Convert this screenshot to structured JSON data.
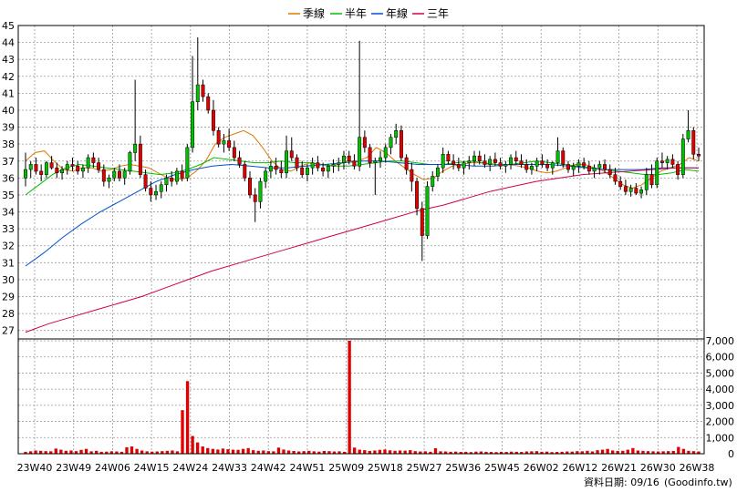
{
  "legend": [
    {
      "label": "季線",
      "color": "#e07800"
    },
    {
      "label": "半年",
      "color": "#00c000"
    },
    {
      "label": "年線",
      "color": "#0050d0"
    },
    {
      "label": "三年",
      "color": "#d0004a"
    }
  ],
  "footer_text": "資料日期: 09/16",
  "source_text": "(Goodinfo.tw)",
  "chart_data": [
    {
      "type": "candlestick",
      "title": "",
      "ylim": [
        26.5,
        45
      ],
      "yticks": [
        27,
        28,
        29,
        30,
        31,
        32,
        33,
        34,
        35,
        36,
        37,
        38,
        39,
        40,
        41,
        42,
        43,
        44,
        45
      ],
      "xticks": [
        "23W40",
        "23W49",
        "24W06",
        "24W15",
        "24W24",
        "24W33",
        "24W42",
        "24W51",
        "25W09",
        "25W18",
        "25W27",
        "25W36",
        "25W45",
        "26W02",
        "26W12",
        "26W21",
        "26W30",
        "26W38"
      ],
      "grid": true,
      "up_color": "#00c000",
      "down_color": "#e00000",
      "candles": [
        [
          36.0,
          37.5,
          35.5,
          36.5
        ],
        [
          36.5,
          37.0,
          36.0,
          36.8
        ],
        [
          36.8,
          37.2,
          36.2,
          36.4
        ],
        [
          36.4,
          36.8,
          35.8,
          36.2
        ],
        [
          36.2,
          37.0,
          36.0,
          36.9
        ],
        [
          36.9,
          37.3,
          36.5,
          36.6
        ],
        [
          36.6,
          36.9,
          36.0,
          36.3
        ],
        [
          36.3,
          36.7,
          35.9,
          36.5
        ],
        [
          36.5,
          37.0,
          36.2,
          36.8
        ],
        [
          36.8,
          37.2,
          36.4,
          36.7
        ],
        [
          36.7,
          37.0,
          36.2,
          36.4
        ],
        [
          36.4,
          36.8,
          36.0,
          36.6
        ],
        [
          36.6,
          37.4,
          36.3,
          37.2
        ],
        [
          37.2,
          37.5,
          36.6,
          36.9
        ],
        [
          36.9,
          37.2,
          36.3,
          36.5
        ],
        [
          36.5,
          36.8,
          35.5,
          35.8
        ],
        [
          35.8,
          36.2,
          35.4,
          36.0
        ],
        [
          36.0,
          36.6,
          35.8,
          36.4
        ],
        [
          36.4,
          36.8,
          35.8,
          36.0
        ],
        [
          36.0,
          36.6,
          35.6,
          36.4
        ],
        [
          36.4,
          37.6,
          36.2,
          37.5
        ],
        [
          37.5,
          41.8,
          37.0,
          38.0
        ],
        [
          38.0,
          38.5,
          36.0,
          36.2
        ],
        [
          36.2,
          36.5,
          35.2,
          35.4
        ],
        [
          35.4,
          35.8,
          34.6,
          35.0
        ],
        [
          35.0,
          35.6,
          34.7,
          35.2
        ],
        [
          35.2,
          35.8,
          34.8,
          35.6
        ],
        [
          35.6,
          36.2,
          35.2,
          36.0
        ],
        [
          36.0,
          36.4,
          35.5,
          35.8
        ],
        [
          35.8,
          36.6,
          35.6,
          36.4
        ],
        [
          36.4,
          36.8,
          35.8,
          36.0
        ],
        [
          36.0,
          38.0,
          35.8,
          37.8
        ],
        [
          37.8,
          43.2,
          37.5,
          40.5
        ],
        [
          40.5,
          44.3,
          40.0,
          41.5
        ],
        [
          41.5,
          41.8,
          40.5,
          40.8
        ],
        [
          40.8,
          41.0,
          39.8,
          40.0
        ],
        [
          40.0,
          40.6,
          38.5,
          38.8
        ],
        [
          38.8,
          39.0,
          37.8,
          38.0
        ],
        [
          38.0,
          38.6,
          37.5,
          38.2
        ],
        [
          38.2,
          38.9,
          37.6,
          37.8
        ],
        [
          37.8,
          38.2,
          37.0,
          37.2
        ],
        [
          37.2,
          37.6,
          36.6,
          36.8
        ],
        [
          36.8,
          37.0,
          35.8,
          36.0
        ],
        [
          36.0,
          36.4,
          34.8,
          35.0
        ],
        [
          35.0,
          35.4,
          33.4,
          34.6
        ],
        [
          34.6,
          36.0,
          34.2,
          35.8
        ],
        [
          35.8,
          36.6,
          35.4,
          36.4
        ],
        [
          36.4,
          37.0,
          36.0,
          36.7
        ],
        [
          36.7,
          37.2,
          36.2,
          36.5
        ],
        [
          36.5,
          37.0,
          36.0,
          36.3
        ],
        [
          36.3,
          38.5,
          36.0,
          37.6
        ],
        [
          37.6,
          38.4,
          37.0,
          37.2
        ],
        [
          37.2,
          37.4,
          36.4,
          36.6
        ],
        [
          36.6,
          37.0,
          36.0,
          36.2
        ],
        [
          36.2,
          36.8,
          35.8,
          36.6
        ],
        [
          36.6,
          37.2,
          36.2,
          36.9
        ],
        [
          36.9,
          37.3,
          36.4,
          36.6
        ],
        [
          36.6,
          36.9,
          36.1,
          36.4
        ],
        [
          36.4,
          36.8,
          36.0,
          36.7
        ],
        [
          36.7,
          37.1,
          36.3,
          36.8
        ],
        [
          36.8,
          37.2,
          36.4,
          36.9
        ],
        [
          36.9,
          37.6,
          36.5,
          37.3
        ],
        [
          37.3,
          37.6,
          36.8,
          37.0
        ],
        [
          37.0,
          37.4,
          36.5,
          36.7
        ],
        [
          36.7,
          44.1,
          36.4,
          38.4
        ],
        [
          38.4,
          38.8,
          37.5,
          37.8
        ],
        [
          37.8,
          38.0,
          36.6,
          36.9
        ],
        [
          36.9,
          37.2,
          35.0,
          37.0
        ],
        [
          37.0,
          37.6,
          36.6,
          37.2
        ],
        [
          37.2,
          38.0,
          36.9,
          37.8
        ],
        [
          37.8,
          38.6,
          37.4,
          38.4
        ],
        [
          38.4,
          39.2,
          38.0,
          38.8
        ],
        [
          38.8,
          39.1,
          37.0,
          37.2
        ],
        [
          37.2,
          37.4,
          36.2,
          36.5
        ],
        [
          36.5,
          36.9,
          35.2,
          35.8
        ],
        [
          35.8,
          36.0,
          33.8,
          34.2
        ],
        [
          34.2,
          34.6,
          31.1,
          32.6
        ],
        [
          32.6,
          35.8,
          32.4,
          35.5
        ],
        [
          35.5,
          36.4,
          35.2,
          36.1
        ],
        [
          36.1,
          36.8,
          35.8,
          36.6
        ],
        [
          36.6,
          37.8,
          36.3,
          37.4
        ],
        [
          37.4,
          37.6,
          36.8,
          37.0
        ],
        [
          37.0,
          37.4,
          36.5,
          36.8
        ],
        [
          36.8,
          37.2,
          36.4,
          36.6
        ],
        [
          36.6,
          37.0,
          36.2,
          36.9
        ],
        [
          36.9,
          37.3,
          36.5,
          37.0
        ],
        [
          37.0,
          37.6,
          36.7,
          37.3
        ],
        [
          37.3,
          37.6,
          36.8,
          37.0
        ],
        [
          37.0,
          37.4,
          36.6,
          36.8
        ],
        [
          36.8,
          37.3,
          36.4,
          37.1
        ],
        [
          37.1,
          37.5,
          36.7,
          36.9
        ],
        [
          36.9,
          37.2,
          36.5,
          36.7
        ],
        [
          36.7,
          37.0,
          36.3,
          36.8
        ],
        [
          36.8,
          37.4,
          36.5,
          37.2
        ],
        [
          37.2,
          37.6,
          36.8,
          37.0
        ],
        [
          37.0,
          37.4,
          36.6,
          36.8
        ],
        [
          36.8,
          37.1,
          36.3,
          36.5
        ],
        [
          36.5,
          36.9,
          36.2,
          36.7
        ],
        [
          36.7,
          37.2,
          36.4,
          37.0
        ],
        [
          37.0,
          37.4,
          36.6,
          36.8
        ],
        [
          36.8,
          37.1,
          36.4,
          36.6
        ],
        [
          36.6,
          37.0,
          36.2,
          36.9
        ],
        [
          36.9,
          38.4,
          36.7,
          37.6
        ],
        [
          37.6,
          37.8,
          36.6,
          36.8
        ],
        [
          36.8,
          37.0,
          36.3,
          36.5
        ],
        [
          36.5,
          36.9,
          36.1,
          36.7
        ],
        [
          36.7,
          37.1,
          36.3,
          36.9
        ],
        [
          36.9,
          37.2,
          36.5,
          36.7
        ],
        [
          36.7,
          37.0,
          36.2,
          36.4
        ],
        [
          36.4,
          36.8,
          36.0,
          36.6
        ],
        [
          36.6,
          37.0,
          36.2,
          36.8
        ],
        [
          36.8,
          37.1,
          36.3,
          36.5
        ],
        [
          36.5,
          36.8,
          36.0,
          36.2
        ],
        [
          36.2,
          36.6,
          35.6,
          35.8
        ],
        [
          35.8,
          36.1,
          35.3,
          35.5
        ],
        [
          35.5,
          35.9,
          35.0,
          35.2
        ],
        [
          35.2,
          35.6,
          34.9,
          35.4
        ],
        [
          35.4,
          35.7,
          35.0,
          35.1
        ],
        [
          35.1,
          35.5,
          34.8,
          35.3
        ],
        [
          35.3,
          36.6,
          35.0,
          36.2
        ],
        [
          36.2,
          36.8,
          35.4,
          35.6
        ],
        [
          35.6,
          37.2,
          35.4,
          37.0
        ],
        [
          37.0,
          37.5,
          36.6,
          36.9
        ],
        [
          36.9,
          37.3,
          36.5,
          37.1
        ],
        [
          37.1,
          37.4,
          36.6,
          36.8
        ],
        [
          36.8,
          37.0,
          35.9,
          36.2
        ],
        [
          36.2,
          38.6,
          36.0,
          38.3
        ],
        [
          38.3,
          40.0,
          38.1,
          38.8
        ],
        [
          38.8,
          39.0,
          37.1,
          37.4
        ],
        [
          37.4,
          37.8,
          37.0,
          37.3
        ]
      ],
      "volume_yticks": [
        "0",
        "1,000",
        "2,000",
        "3,000",
        "4,000",
        "5,000",
        "6,000",
        "7,000"
      ],
      "volume_ylim": [
        0,
        7000
      ],
      "volume": [
        120,
        150,
        200,
        180,
        160,
        150,
        320,
        250,
        180,
        200,
        160,
        240,
        300,
        150,
        180,
        120,
        130,
        150,
        140,
        120,
        400,
        450,
        300,
        200,
        150,
        130,
        140,
        160,
        180,
        200,
        150,
        2700,
        4500,
        1100,
        700,
        450,
        350,
        300,
        260,
        320,
        280,
        250,
        240,
        300,
        350,
        220,
        180,
        200,
        160,
        150,
        380,
        260,
        200,
        170,
        140,
        160,
        180,
        150,
        130,
        170,
        160,
        140,
        150,
        120,
        7000,
        380,
        250,
        220,
        170,
        200,
        240,
        260,
        210,
        180,
        200,
        190,
        220,
        160,
        140,
        150,
        120,
        340,
        150,
        140,
        120,
        130,
        110,
        120,
        100,
        130,
        140,
        120,
        110,
        100,
        120,
        110,
        130,
        120,
        110,
        140,
        150,
        160,
        120,
        130,
        100,
        110,
        120,
        140,
        130,
        160,
        150,
        180,
        140,
        220,
        250,
        300,
        200,
        170,
        180,
        250,
        350,
        200,
        180,
        160,
        150,
        140,
        150,
        160,
        170,
        420,
        300,
        180,
        160,
        140
      ],
      "series": [
        {
          "name": "季線",
          "color": "#e07800",
          "values": [
            37.0,
            37.5,
            37.6,
            37.0,
            36.5,
            36.4,
            36.6,
            36.6,
            36.4,
            36.5,
            36.7,
            36.8,
            36.7,
            36.6,
            36.3,
            36.0,
            35.9,
            36.0,
            36.4,
            37.0,
            38.0,
            38.4,
            38.6,
            38.8,
            38.5,
            37.8,
            37.0,
            36.5,
            36.4,
            36.7,
            36.9,
            36.8,
            36.7,
            36.8,
            37.0,
            37.0,
            37.2,
            37.8,
            37.5,
            37.0,
            36.6,
            36.2,
            35.9,
            36.0,
            36.4,
            36.7,
            36.8,
            36.9,
            36.9,
            36.8,
            36.8,
            36.8,
            36.7,
            36.6,
            36.4,
            36.3,
            36.4,
            36.6,
            36.8,
            36.8,
            36.6,
            36.4,
            36.0,
            35.6,
            35.4,
            35.6,
            36.0,
            36.4,
            36.6,
            36.8,
            37.2,
            37.0
          ]
        },
        {
          "name": "半年",
          "color": "#00c000",
          "values": [
            35.0,
            35.6,
            36.2,
            36.6,
            36.8,
            36.7,
            36.6,
            36.5,
            36.4,
            36.3,
            36.2,
            36.3,
            36.5,
            36.8,
            37.2,
            37.1,
            37.0,
            36.9,
            36.9,
            37.0,
            36.9,
            36.9,
            36.8,
            36.7,
            36.7,
            36.8,
            36.9,
            37.0,
            37.0,
            36.9,
            36.8,
            36.8,
            36.9,
            37.0,
            36.9,
            36.8,
            36.8,
            36.9,
            37.0,
            36.9,
            36.8,
            36.7,
            36.6,
            36.5,
            36.4,
            36.3,
            36.2,
            36.2,
            36.3,
            36.5,
            36.4
          ]
        },
        {
          "name": "年線",
          "color": "#0050d0",
          "values": [
            30.8,
            31.6,
            32.5,
            33.3,
            34.0,
            34.6,
            35.2,
            35.8,
            36.2,
            36.5,
            36.7,
            36.8,
            36.7,
            36.6,
            36.6,
            36.7,
            36.8,
            36.9,
            37.0,
            37.0,
            36.9,
            36.8,
            36.8,
            36.8,
            36.7,
            36.7,
            36.8,
            36.8,
            36.8,
            36.7,
            36.6,
            36.5,
            36.5,
            36.5,
            36.6,
            36.6,
            36.6
          ]
        },
        {
          "name": "三年",
          "color": "#d0004a",
          "values": [
            26.9,
            27.4,
            27.8,
            28.2,
            28.6,
            29.0,
            29.5,
            30.0,
            30.5,
            30.9,
            31.3,
            31.7,
            32.1,
            32.5,
            32.9,
            33.3,
            33.7,
            34.1,
            34.4,
            34.8,
            35.2,
            35.5,
            35.8,
            36.0,
            36.2,
            36.3,
            36.4,
            36.5,
            36.6,
            36.6
          ]
        }
      ]
    }
  ]
}
